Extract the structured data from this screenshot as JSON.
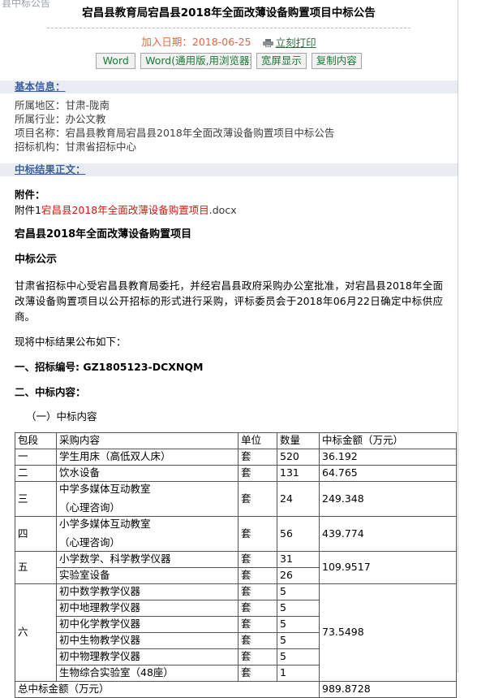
{
  "browser": {
    "ghost_tab_text": "县中标公告"
  },
  "header": {
    "title": "宕昌县教育局宕昌县2018年全面改薄设备购置项目中标公告",
    "date_label": "加入日期：2018-06-25",
    "print_icon": "printer-icon",
    "print_label": "立刻打印"
  },
  "toolbar": {
    "buttons": [
      {
        "label": "Word",
        "name": "word-button"
      },
      {
        "label": "Word(通用版,用浏览器查",
        "name": "word-generic-button"
      },
      {
        "label": "宽屏显示",
        "name": "widescreen-button"
      },
      {
        "label": "复制内容",
        "name": "copy-content-button"
      }
    ]
  },
  "basic_info": {
    "band_label": "基本信息：",
    "rows": [
      "所属地区：甘肃-陇南",
      "所属行业：办公文教",
      "项目名称：宕昌县教育局宕昌县2018年全面改薄设备购置项目中标公告",
      "招标机构：甘肃省招标中心"
    ]
  },
  "result_body": {
    "band_label": "中标结果正文：",
    "attachment_heading": "附件：",
    "attachment_prefix": "附件1",
    "attachment_link": "宕昌县2018年全面改薄设备购置项目",
    "attachment_ext": ".docx",
    "project_title": "宕昌县2018年全面改薄设备购置项目",
    "publish_title": "中标公示",
    "paragraph1": "甘肃省招标中心受宕昌县教育局委托，并经宕昌县政府采购办公室批准，对宕昌县2018年全面改薄设备购置项目以公开招标的形式进行采购，评标委员会于2018年06月22日确定中标供应商。",
    "paragraph2": "现将中标结果公布如下：",
    "section1": "一、招标编号: GZ1805123-DCXNQM",
    "section2": "二、中标内容：",
    "subsection1": "（一）中标内容"
  },
  "bid_table": {
    "headers": [
      "包段",
      "采购内容",
      "单位",
      "数量",
      "中标金额（万元）"
    ],
    "rows": [
      {
        "package": "一",
        "items": [
          {
            "content": "学生用床（高低双人床）",
            "unit": "套",
            "qty": "520"
          }
        ],
        "amount": "36.192"
      },
      {
        "package": "二",
        "items": [
          {
            "content": "饮水设备",
            "unit": "套",
            "qty": "131"
          }
        ],
        "amount": "64.765"
      },
      {
        "package": "三",
        "items": [
          {
            "content": "中学多媒体互动教室",
            "content_line2": "（心理咨询）",
            "unit": "套",
            "qty": "24"
          }
        ],
        "amount": "249.348"
      },
      {
        "package": "四",
        "items": [
          {
            "content": "小学多媒体互动教室",
            "content_line2": "（心理咨询）",
            "unit": "套",
            "qty": "56"
          }
        ],
        "amount": "439.774"
      },
      {
        "package": "五",
        "items": [
          {
            "content": "小学数学、科学教学仪器",
            "unit": "套",
            "qty": "31"
          },
          {
            "content": "实验室设备",
            "unit": "套",
            "qty": "26"
          }
        ],
        "amount": "109.9517"
      },
      {
        "package": "六",
        "items": [
          {
            "content": "初中数学教学仪器",
            "unit": "套",
            "qty": "5"
          },
          {
            "content": "初中地理教学仪器",
            "unit": "套",
            "qty": "5"
          },
          {
            "content": "初中化学教学仪器",
            "unit": "套",
            "qty": "5"
          },
          {
            "content": "初中生物教学仪器",
            "unit": "套",
            "qty": "5"
          },
          {
            "content": "初中物理教学仪器",
            "unit": "套",
            "qty": "5"
          },
          {
            "content": "生物综合实验室（48座）",
            "unit": "套",
            "qty": "1"
          }
        ],
        "amount": "73.5498"
      }
    ],
    "total_label": "总中标金额（万元）",
    "total_value": "989.8728"
  },
  "colors": {
    "date": "#e8663d",
    "band_bg": "#e9edf3",
    "band_text": "#3f5f9f",
    "button_text": "#1a7a37",
    "attachment_link": "#d01a10",
    "print_link": "#2f6f3f"
  }
}
